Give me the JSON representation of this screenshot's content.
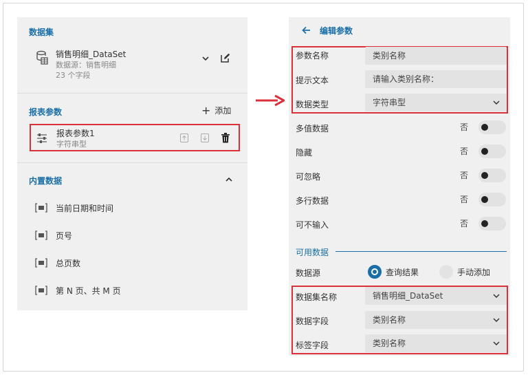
{
  "left": {
    "dataset_section": "数据集",
    "dataset_name": "销售明细_DataSet",
    "dataset_source": "数据源：销售明细",
    "dataset_fields": "23 个字段",
    "report_params_section": "报表参数",
    "add_label": "添加",
    "param": {
      "name": "报表参数1",
      "type": "字符串型"
    },
    "builtin_section": "内置数据",
    "builtin_items": [
      "当前日期和时间",
      "页号",
      "总页数",
      "第 N 页、共 M 页"
    ]
  },
  "right": {
    "title": "编辑参数",
    "param_name_label": "参数名称",
    "param_name_value": "类别名称",
    "prompt_label": "提示文本",
    "prompt_value": "请输入类别名称：",
    "data_type_label": "数据类型",
    "data_type_value": "字符串型",
    "toggles": [
      {
        "label": "多值数据",
        "state": "否"
      },
      {
        "label": "隐藏",
        "state": "否"
      },
      {
        "label": "可忽略",
        "state": "否"
      },
      {
        "label": "多行数据",
        "state": "否"
      },
      {
        "label": "可不输入",
        "state": "否"
      }
    ],
    "available_section": "可用数据",
    "source_label": "数据源",
    "source_option_query": "查询结果",
    "source_option_manual": "手动添加",
    "dataset_label": "数据集名称",
    "dataset_value": "销售明细_DataSet",
    "data_field_label": "数据字段",
    "data_field_value": "类别名称",
    "label_field_label": "标签字段",
    "label_field_value": "类别名称"
  },
  "colors": {
    "accent": "#1b6fa8",
    "highlight": "#d9303a",
    "panel": "#f0f0f0"
  }
}
